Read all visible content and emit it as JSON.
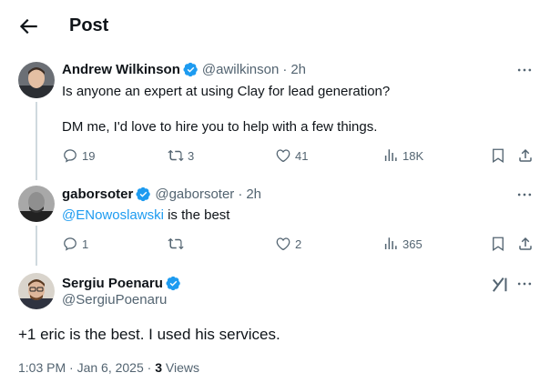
{
  "header": {
    "title": "Post",
    "back_icon": "arrow-left-icon"
  },
  "replies": [
    {
      "name": "Andrew Wilkinson",
      "handle": "@awilkinson",
      "time": "2h",
      "lines": [
        "Is anyone an expert at using Clay for lead generation?",
        "DM me, I'd love to hire you to help with a few things."
      ],
      "stats": {
        "replies": "19",
        "reposts": "3",
        "likes": "41",
        "views": "18K"
      }
    },
    {
      "name": "gaborsoter",
      "handle": "@gaborsoter",
      "time": "2h",
      "mention": "@ENowoslawski",
      "text_after": " is the best",
      "stats": {
        "replies": "1",
        "reposts": "",
        "likes": "2",
        "views": "365"
      }
    }
  ],
  "main_post": {
    "name": "Sergiu Poenaru",
    "handle": "@SergiuPoenaru",
    "text": "+1 eric is the best. I used his services.",
    "time": "1:03 PM · Jan 6, 2025 · ",
    "views_count": "3",
    "views_label": " Views"
  },
  "colors": {
    "accent": "#1d9bf0",
    "muted": "#536471",
    "text": "#0f1419",
    "line": "#cfd9de"
  }
}
